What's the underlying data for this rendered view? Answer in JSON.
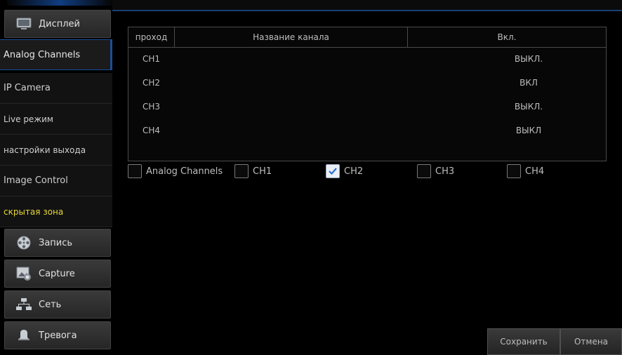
{
  "sidebar": {
    "main": [
      {
        "label": "Дисплей",
        "icon": "monitor-icon"
      },
      {
        "label": "Запись",
        "icon": "film-reel-icon"
      },
      {
        "label": "Capture",
        "icon": "image-capture-icon"
      },
      {
        "label": "Сеть",
        "icon": "network-icon"
      },
      {
        "label": "Тревога",
        "icon": "alarm-bell-icon"
      }
    ],
    "sub": [
      {
        "label": "Analog Channels"
      },
      {
        "label": "IP Camera"
      },
      {
        "label": "Live режим"
      },
      {
        "label": "настройки выхода"
      },
      {
        "label": "Image Control"
      },
      {
        "label": "скрытая зона"
      }
    ]
  },
  "table": {
    "headers": [
      "проход",
      "Название канала",
      "Вкл."
    ],
    "rows": [
      {
        "channel": "CH1",
        "name": "",
        "enabled": "ВЫКЛ."
      },
      {
        "channel": "CH2",
        "name": "",
        "enabled": "ВКЛ"
      },
      {
        "channel": "CH3",
        "name": "",
        "enabled": "ВЫКЛ."
      },
      {
        "channel": "CH4",
        "name": "",
        "enabled": "ВЫКЛ"
      }
    ]
  },
  "checkboxes": [
    {
      "label": "Analog Channels",
      "checked": false
    },
    {
      "label": "CH1",
      "checked": false
    },
    {
      "label": "CH2",
      "checked": true
    },
    {
      "label": "CH3",
      "checked": false
    },
    {
      "label": "CH4",
      "checked": false
    }
  ],
  "buttons": {
    "save": "Сохранить",
    "cancel": "Отмена"
  },
  "colors": {
    "accent": "#1a4e9a",
    "highlight_text": "#e7d83a",
    "checkmark": "#2e6fd6"
  }
}
